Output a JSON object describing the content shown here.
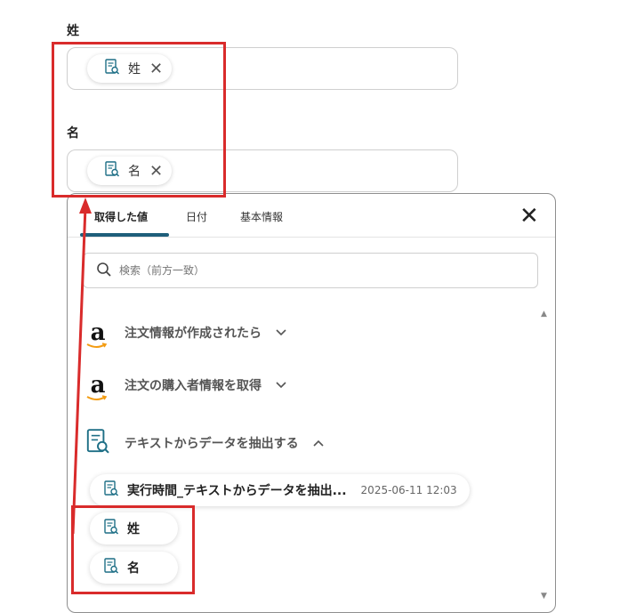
{
  "fields": [
    {
      "label": "姓",
      "chip": "姓"
    },
    {
      "label": "名",
      "chip": "名"
    }
  ],
  "panel": {
    "tabs": [
      "取得した値",
      "日付",
      "基本情報"
    ],
    "close_label": "✕",
    "search_placeholder": "検索（前方一致）",
    "sections": [
      {
        "title": "注文情報が作成されたら",
        "icon": "amazon-logo-icon",
        "expanded": false
      },
      {
        "title": "注文の購入者情報を取得",
        "icon": "amazon-logo-icon",
        "expanded": false
      },
      {
        "title": "テキストからデータを抽出する",
        "icon": "document-search-icon",
        "expanded": true
      }
    ],
    "items": [
      {
        "label": "実行時間_テキストからデータを抽出...",
        "timestamp": "2025-06-11 12:03"
      },
      {
        "label": "姓",
        "timestamp": ""
      },
      {
        "label": "名",
        "timestamp": ""
      }
    ]
  },
  "colors": {
    "accent": "#1e5e7a",
    "highlight": "#d92b2b",
    "icon": "#1e6f86"
  }
}
